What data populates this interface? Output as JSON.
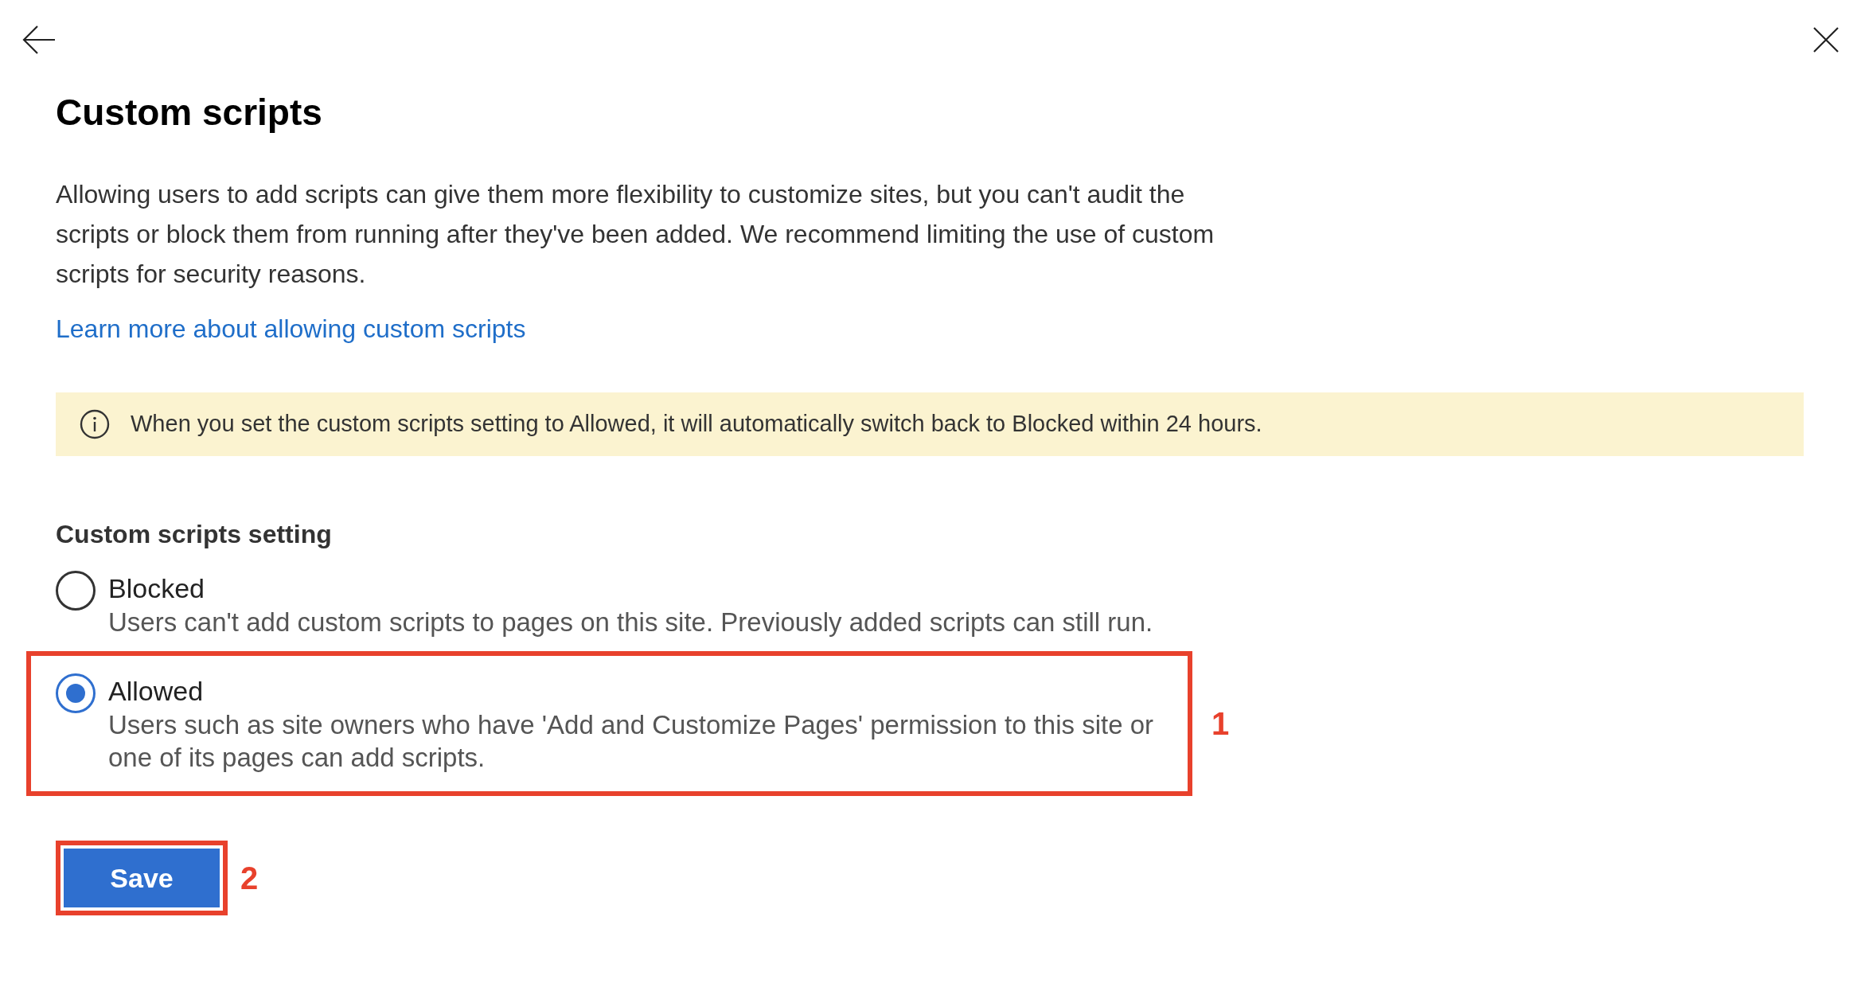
{
  "panel": {
    "title": "Custom scripts",
    "description": "Allowing users to add scripts can give them more flexibility to customize sites, but you can't audit the scripts or block them from running after they've been added. We recommend limiting the use of custom scripts for security reasons.",
    "link": "Learn more about allowing custom scripts",
    "notice": "When you set the custom scripts setting to Allowed, it will automatically switch back to Blocked within 24 hours.",
    "setting_heading": "Custom scripts setting",
    "options": [
      {
        "label": "Blocked",
        "description": "Users can't add custom scripts to pages on this site. Previously added scripts can still run.",
        "selected": false
      },
      {
        "label": "Allowed",
        "description": "Users such as site owners who have 'Add and Customize Pages' permission to this site or one of its pages can add scripts.",
        "selected": true,
        "callout": "1"
      }
    ],
    "save_button": {
      "label": "Save",
      "callout": "2"
    }
  }
}
